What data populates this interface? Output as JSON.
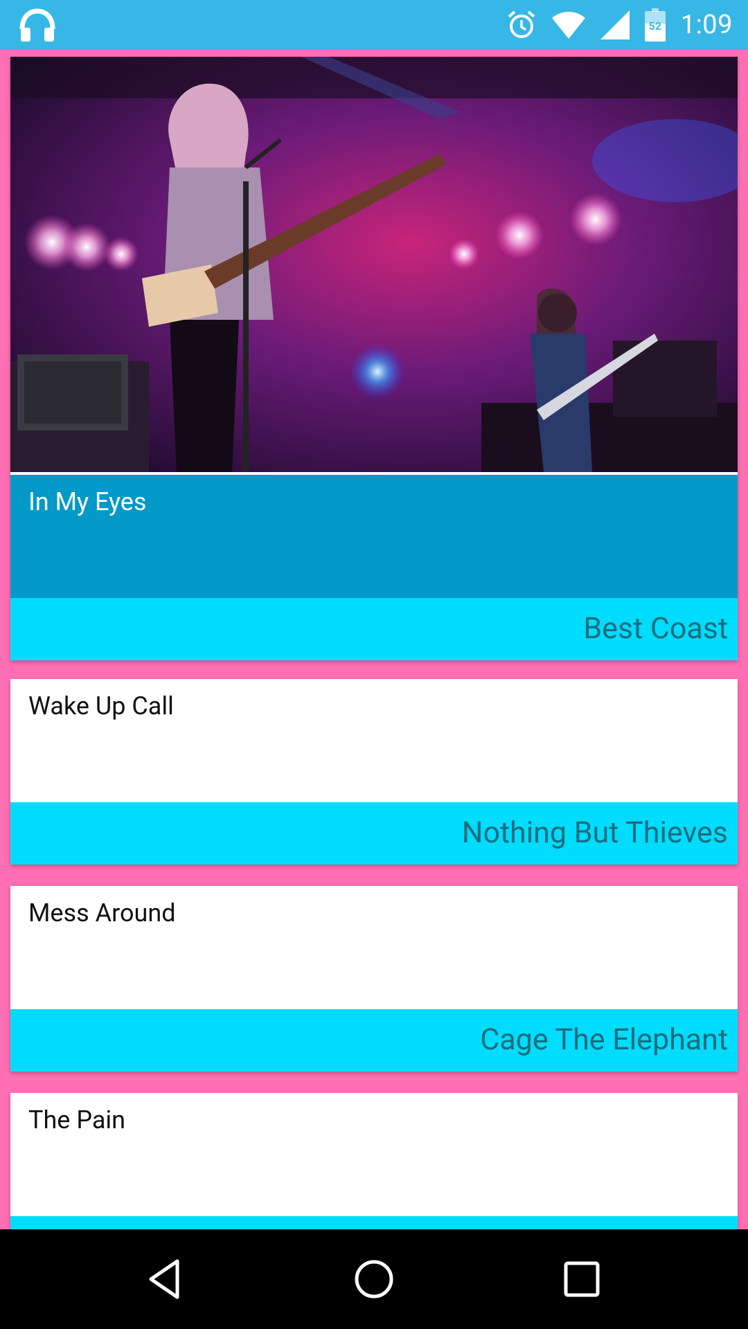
{
  "status_bar": {
    "left_icon": "headphones-icon",
    "icons": [
      "alarm-icon",
      "wifi-icon",
      "signal-icon",
      "battery-icon"
    ],
    "battery_level": "52",
    "time": "1:09"
  },
  "songs": [
    {
      "title": "In My Eyes",
      "artist": "Best Coast",
      "has_image": true
    },
    {
      "title": "Wake Up Call",
      "artist": "Nothing But Thieves",
      "has_image": false
    },
    {
      "title": "Mess Around",
      "artist": "Cage The Elephant",
      "has_image": false
    },
    {
      "title": "The Pain",
      "artist": "",
      "has_image": false
    }
  ],
  "nav": {
    "buttons": [
      "back-icon",
      "home-icon",
      "recents-icon"
    ]
  },
  "colors": {
    "status_bar": "#36b7e6",
    "background": "#ff6fb4",
    "featured_title_bg": "#0399c8",
    "artist_bar": "#00dcfd",
    "artist_text": "#1a6c7d"
  }
}
